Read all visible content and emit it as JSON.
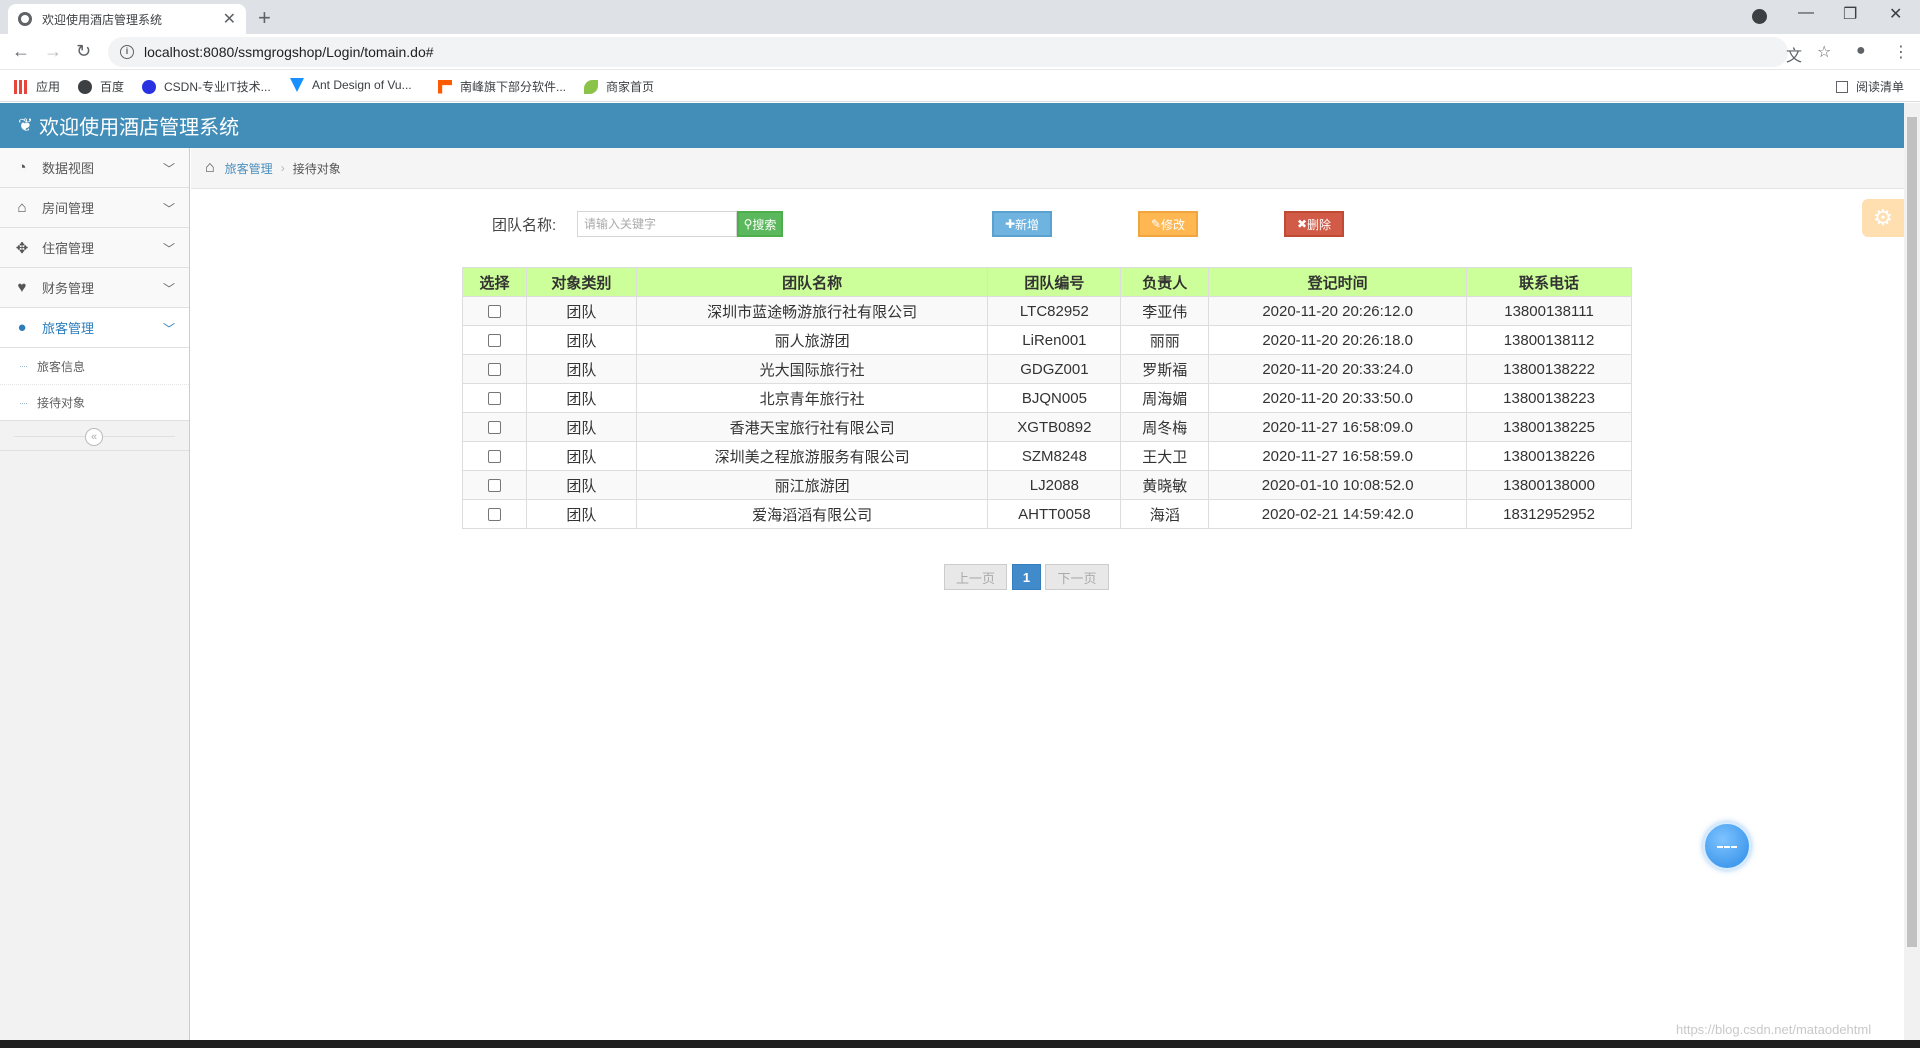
{
  "browser": {
    "tab_title": "欢迎使用酒店管理系统",
    "new_tab": "+",
    "url": "localhost:8080/ssmgrogshop/Login/tomain.do#",
    "bookmarks": [
      {
        "label": "应用",
        "icon": "apps-grid-icon"
      },
      {
        "label": "百度",
        "icon": "globe-icon"
      },
      {
        "label": "CSDN-专业IT技术...",
        "icon": "paw-icon"
      },
      {
        "label": "Ant Design of Vu...",
        "icon": "vue-icon"
      },
      {
        "label": "南峰旗下部分软件...",
        "icon": "flag-icon"
      },
      {
        "label": "商家首页",
        "icon": "leaf-icon"
      }
    ],
    "reading_list": "阅读清单"
  },
  "app": {
    "title": "欢迎使用酒店管理系统",
    "header_color": "#438eb9"
  },
  "sidebar": {
    "items": [
      {
        "label": "数据视图",
        "icon": "dashboard-icon"
      },
      {
        "label": "房间管理",
        "icon": "home-icon"
      },
      {
        "label": "住宿管理",
        "icon": "move-arrows-icon"
      },
      {
        "label": "财务管理",
        "icon": "heart-icon"
      },
      {
        "label": "旅客管理",
        "icon": "user-icon"
      }
    ],
    "subitems": [
      "旅客信息",
      "接待对象"
    ]
  },
  "breadcrumb": {
    "link": "旅客管理",
    "current": "接待对象"
  },
  "search": {
    "label": "团队名称:",
    "placeholder": "请输入关键字",
    "button": "搜索"
  },
  "actions": {
    "add": "新增",
    "edit": "修改",
    "delete": "删除"
  },
  "table": {
    "headers": [
      "选择",
      "对象类别",
      "团队名称",
      "团队编号",
      "负责人",
      "登记时间",
      "联系电话"
    ],
    "rows": [
      [
        "团队",
        "深圳市蓝途畅游旅行社有限公司",
        "LTC82952",
        "李亚伟",
        "2020-11-20 20:26:12.0",
        "13800138111"
      ],
      [
        "团队",
        "丽人旅游团",
        "LiRen001",
        "丽丽",
        "2020-11-20 20:26:18.0",
        "13800138112"
      ],
      [
        "团队",
        "光大国际旅行社",
        "GDGZ001",
        "罗斯福",
        "2020-11-20 20:33:24.0",
        "13800138222"
      ],
      [
        "团队",
        "北京青年旅行社",
        "BJQN005",
        "周海媚",
        "2020-11-20 20:33:50.0",
        "13800138223"
      ],
      [
        "团队",
        "香港天宝旅行社有限公司",
        "XGTB0892",
        "周冬梅",
        "2020-11-27 16:58:09.0",
        "13800138225"
      ],
      [
        "团队",
        "深圳美之程旅游服务有限公司",
        "SZM8248",
        "王大卫",
        "2020-11-27 16:58:59.0",
        "13800138226"
      ],
      [
        "团队",
        "丽江旅游团",
        "LJ2088",
        "黄晓敏",
        "2020-01-10 10:08:52.0",
        "13800138000"
      ],
      [
        "团队",
        "爱海滔滔有限公司",
        "AHTT0058",
        "海滔",
        "2020-02-21 14:59:42.0",
        "18312952952"
      ]
    ]
  },
  "pagination": {
    "prev": "上一页",
    "current": "1",
    "next": "下一页"
  },
  "watermark": "https://blog.csdn.net/mataodehtml"
}
